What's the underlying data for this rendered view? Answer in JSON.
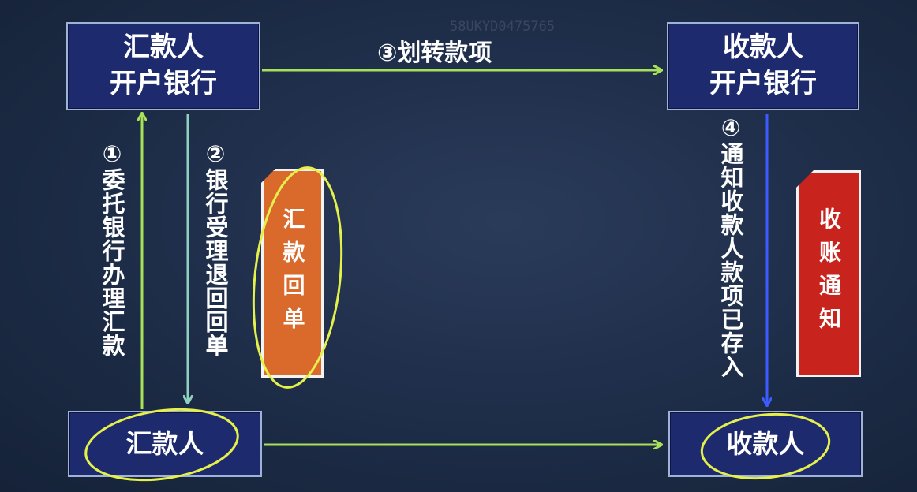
{
  "watermark": "58UKYD0475765",
  "nodes": {
    "payer_bank": {
      "line1": "汇款人",
      "line2": "开户银行"
    },
    "payee_bank": {
      "line1": "收款人",
      "line2": "开户银行"
    },
    "payer": {
      "label": "汇款人"
    },
    "payee": {
      "label": "收款人"
    }
  },
  "steps": {
    "step1": "①委托银行办理汇款",
    "step2": "②银行受理退回回单",
    "step3": "③划转款项",
    "step4": "④通知收款人款项已存入"
  },
  "documents": {
    "remit_receipt": "汇款回单",
    "receipt_notice": "收账通知"
  },
  "colors": {
    "background": "#1d2c47",
    "box_fill": "#1d2a6e",
    "arrow_green": "#a8e05a",
    "arrow_teal": "#8fd0c0",
    "arrow_blue": "#3d5cff",
    "highlight_yellow": "#e6f04a",
    "remit_card": "#d96a2b",
    "notice_card": "#c8231d"
  }
}
